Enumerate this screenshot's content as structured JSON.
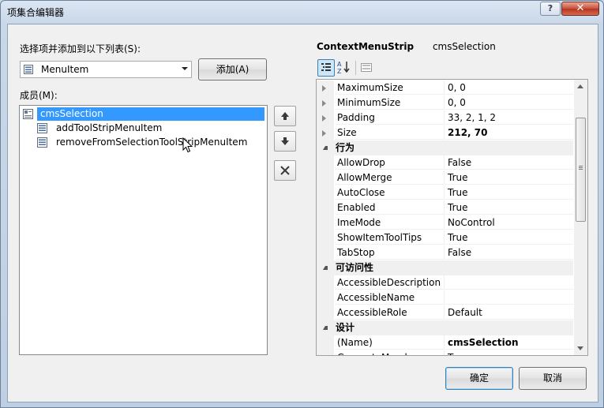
{
  "window": {
    "title": "项集合编辑器",
    "help_label": "?",
    "close_label": "✕"
  },
  "left": {
    "select_label": "选择项并添加到以下列表(S):",
    "combo_value": "MenuItem",
    "add_button": "添加(A)",
    "members_label": "成员(M):",
    "members": [
      {
        "label": "cmsSelection",
        "selected": true
      },
      {
        "label": "addToolStripMenuItem",
        "selected": false
      },
      {
        "label": "removeFromSelectionToolStripMenuItem",
        "selected": false
      }
    ]
  },
  "right": {
    "object_type": "ContextMenuStrip",
    "object_name": "cmsSelection",
    "rows": [
      {
        "kind": "prop",
        "name": "MaximumSize",
        "value": "0, 0",
        "expandable": true,
        "bold": false
      },
      {
        "kind": "prop",
        "name": "MinimumSize",
        "value": "0, 0",
        "expandable": true,
        "bold": false
      },
      {
        "kind": "prop",
        "name": "Padding",
        "value": "33, 2, 1, 2",
        "expandable": true,
        "bold": false
      },
      {
        "kind": "prop",
        "name": "Size",
        "value": "212, 70",
        "expandable": true,
        "bold": true
      },
      {
        "kind": "cat",
        "name": "行为"
      },
      {
        "kind": "prop",
        "name": "AllowDrop",
        "value": "False",
        "expandable": false,
        "bold": false
      },
      {
        "kind": "prop",
        "name": "AllowMerge",
        "value": "True",
        "expandable": false,
        "bold": false
      },
      {
        "kind": "prop",
        "name": "AutoClose",
        "value": "True",
        "expandable": false,
        "bold": false
      },
      {
        "kind": "prop",
        "name": "Enabled",
        "value": "True",
        "expandable": false,
        "bold": false
      },
      {
        "kind": "prop",
        "name": "ImeMode",
        "value": "NoControl",
        "expandable": false,
        "bold": false
      },
      {
        "kind": "prop",
        "name": "ShowItemToolTips",
        "value": "True",
        "expandable": false,
        "bold": false
      },
      {
        "kind": "prop",
        "name": "TabStop",
        "value": "False",
        "expandable": false,
        "bold": false
      },
      {
        "kind": "cat",
        "name": "可访问性"
      },
      {
        "kind": "prop",
        "name": "AccessibleDescription",
        "value": "",
        "expandable": false,
        "bold": false
      },
      {
        "kind": "prop",
        "name": "AccessibleName",
        "value": "",
        "expandable": false,
        "bold": false
      },
      {
        "kind": "prop",
        "name": "AccessibleRole",
        "value": "Default",
        "expandable": false,
        "bold": false
      },
      {
        "kind": "cat",
        "name": "设计"
      },
      {
        "kind": "prop",
        "name": "(Name)",
        "value": "cmsSelection",
        "expandable": false,
        "bold": true
      },
      {
        "kind": "prop",
        "name": "GenerateMember",
        "value": "True",
        "expandable": false,
        "bold": false
      }
    ]
  },
  "footer": {
    "ok": "确定",
    "cancel": "取消"
  }
}
